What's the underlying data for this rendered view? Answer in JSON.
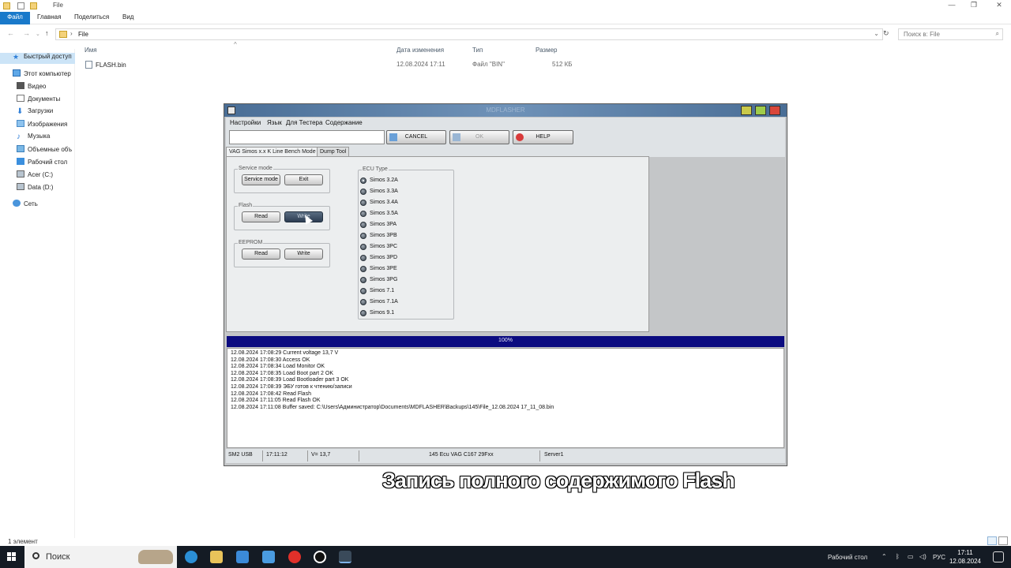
{
  "explorer": {
    "window_title": "File",
    "ribbon_tabs": [
      "Файл",
      "Главная",
      "Поделиться",
      "Вид"
    ],
    "address_path": "File",
    "search_placeholder": "Поиск в: File",
    "columns": {
      "name": "Имя",
      "date": "Дата изменения",
      "type": "Тип",
      "size": "Размер"
    },
    "files": [
      {
        "name": "FLASH.bin",
        "date": "12.08.2024 17:11",
        "type": "Файл \"BIN\"",
        "size": "512 КБ"
      }
    ],
    "nav": {
      "quick_access": "Быстрый доступ",
      "this_pc": "Этот компьютер",
      "items": [
        "Видео",
        "Документы",
        "Загрузки",
        "Изображения",
        "Музыка",
        "Объемные объ",
        "Рабочий стол",
        "Acer (C:)",
        "Data (D:)"
      ],
      "network": "Сеть"
    },
    "status": "1 элемент"
  },
  "mdflasher": {
    "title": "MDFLASHER",
    "menu": [
      "Настройки",
      "Язык",
      "Для Тестера",
      "Содержание"
    ],
    "toolbar": {
      "cancel": "CANCEL",
      "ok": "OK",
      "help": "HELP"
    },
    "tabs": [
      "VAG Simos x.x K Line Bench Mode",
      "Dump Tool"
    ],
    "groups": {
      "service_mode": {
        "label": "Service mode",
        "btn1": "Service mode",
        "btn2": "Exit"
      },
      "flash": {
        "label": "Flash",
        "btn1": "Read",
        "btn2": "Write"
      },
      "eeprom": {
        "label": "EEPROM",
        "btn1": "Read",
        "btn2": "Write"
      }
    },
    "ecu_type": {
      "label": "ECU Type",
      "selected_index": 0,
      "options": [
        "Simos 3.2A",
        "Simos 3.3A",
        "Simos 3.4A",
        "Simos 3.5A",
        "Simos 3PA",
        "Simos 3PB",
        "Simos 3PC",
        "Simos 3PD",
        "Simos 3PE",
        "Simos 3PG",
        "Simos 7.1",
        "Simos 7.1A",
        "Simos 9.1"
      ]
    },
    "progress": {
      "text": "100%",
      "value": 1.0
    },
    "log": [
      "12.08.2024 17:08:29  Current voltage 13,7 V",
      "12.08.2024 17:08:30  Access OK",
      "12.08.2024 17:08:34  Load Monitor OK",
      "12.08.2024 17:08:35  Load Boot part 2 OK",
      "12.08.2024 17:08:39  Load Bootloader part 3 OK",
      "12.08.2024 17:08:39  ЭБУ готов к чтению/записи",
      "12.08.2024 17:08:42  Read Flash",
      "12.08.2024 17:11:05  Read Flash OK",
      "12.08.2024 17:11:08  Buffer saved:  C:\\Users\\Администратор\\Documents\\MDFLASHER\\Backups\\145\\File_12.08.2024 17_11_08.bin"
    ],
    "status": {
      "interface": "SM2 USB",
      "time": "17:11:12",
      "voltage": "V= 13,7",
      "ecu": "145 Ecu VAG C167 29Fxx",
      "server": "Server1"
    }
  },
  "subtitle": "Запись полного содержимого  Flash",
  "taskbar": {
    "search": "Поиск",
    "desktop_label": "Рабочий стол",
    "lang": "РУС",
    "time": "17:11",
    "date": "12.08.2024"
  }
}
